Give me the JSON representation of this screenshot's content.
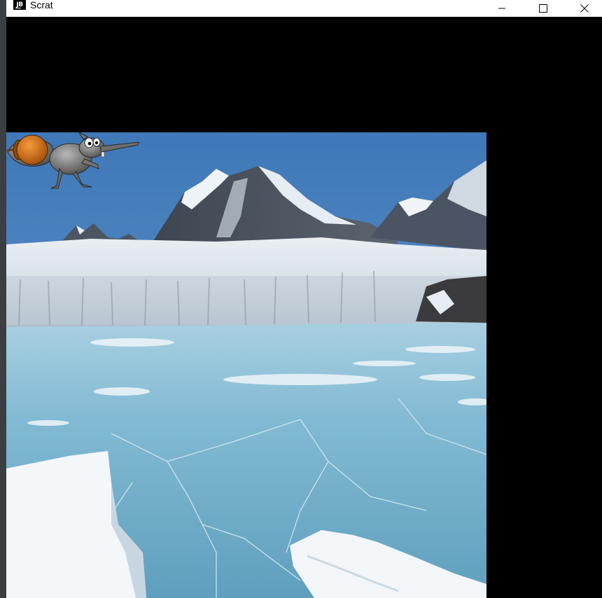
{
  "window": {
    "title": "Scrat",
    "app_icon_text": "JB"
  },
  "controls": {
    "minimize": "minimize-icon",
    "maximize": "maximize-icon",
    "close": "close-icon"
  },
  "scene": {
    "background": "frozen-lake-glacier-mountains",
    "sprites": [
      "scrat-squirrel",
      "acorn"
    ]
  },
  "colors": {
    "sky": "#4f86c2",
    "ice": "#7fb6d4",
    "acorn": "#e07b1f"
  }
}
